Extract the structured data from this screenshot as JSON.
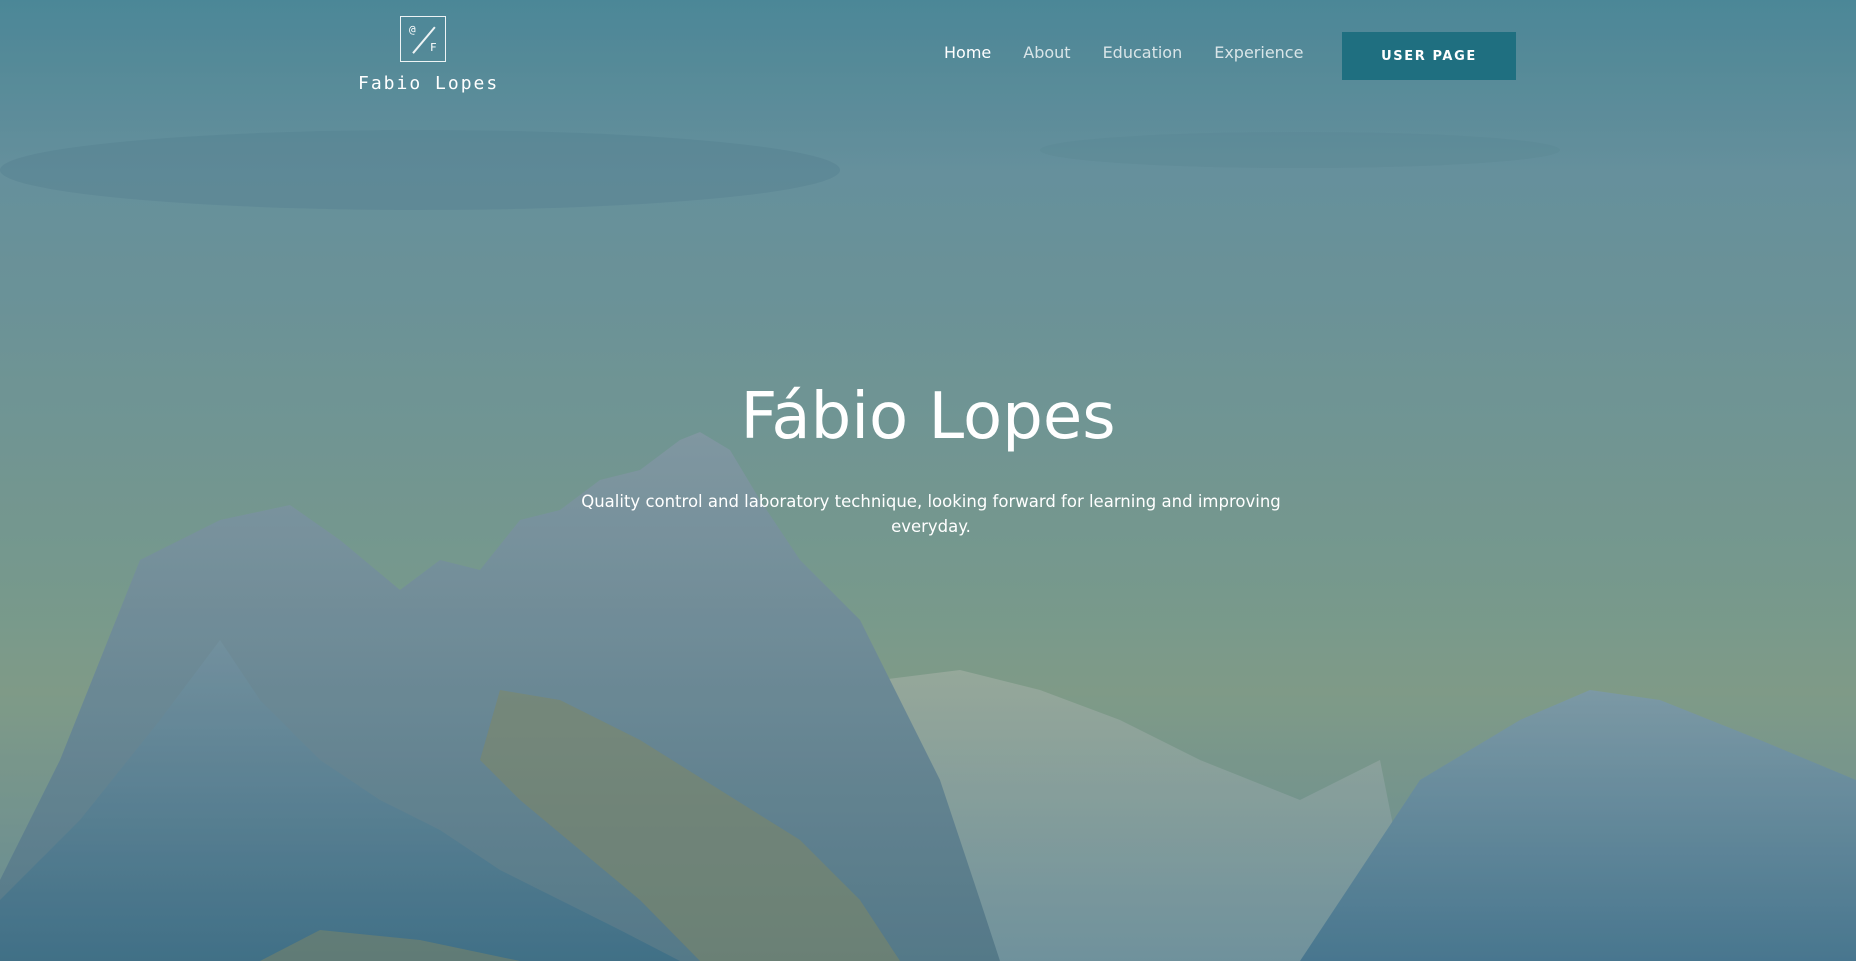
{
  "logo": {
    "mark_left": "@",
    "mark_right": "F",
    "name": "Fabio Lopes"
  },
  "nav": {
    "items": [
      {
        "label": "Home",
        "active": true
      },
      {
        "label": "About",
        "active": false
      },
      {
        "label": "Education",
        "active": false
      },
      {
        "label": "Experience",
        "active": false
      }
    ]
  },
  "header": {
    "user_button_label": "USER PAGE"
  },
  "hero": {
    "title": "Fábio Lopes",
    "subtitle": "Quality control and laboratory technique, looking forward for learning and improving everyday."
  },
  "colors": {
    "accent": "#1f6f80",
    "text": "#ffffff"
  },
  "icons": {
    "logo": "monogram-logo-icon"
  }
}
